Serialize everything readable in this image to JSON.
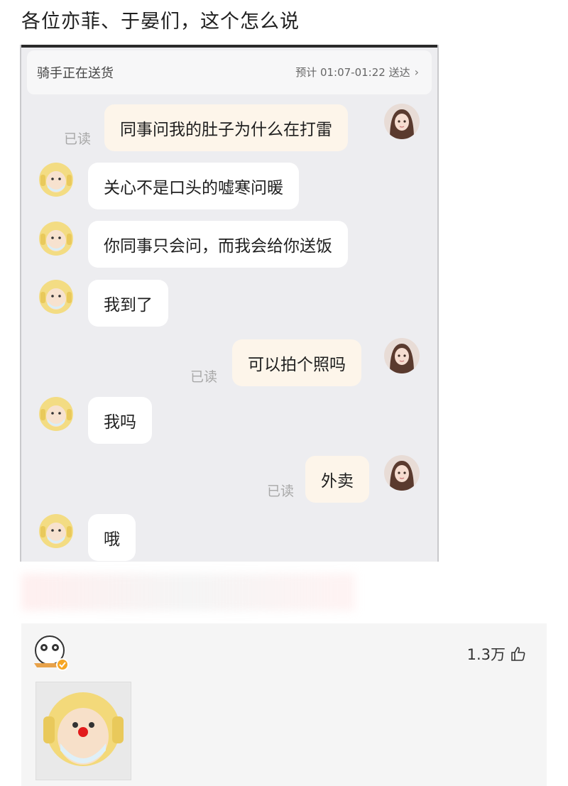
{
  "post": {
    "title": "各位亦菲、于晏们，这个怎么说"
  },
  "screenshot": {
    "status": "骑手正在送货",
    "eta": "预计 01:07-01:22 送达",
    "read_label": "已读",
    "messages": [
      {
        "from": "user",
        "text": "同事问我的肚子为什么在打雷"
      },
      {
        "from": "rider",
        "text": "关心不是口头的嘘寒问暖"
      },
      {
        "from": "rider",
        "text": "你同事只会问，而我会给你送饭"
      },
      {
        "from": "rider",
        "text": "我到了"
      },
      {
        "from": "user",
        "text": "可以拍个照吗"
      },
      {
        "from": "rider",
        "text": "我吗"
      },
      {
        "from": "user",
        "text": "外卖"
      },
      {
        "from": "rider",
        "text": "哦"
      }
    ]
  },
  "comment": {
    "likes": "1.3万",
    "like_icon": "thumbs-up-icon",
    "badge_icon": "verified-badge-icon"
  },
  "colors": {
    "user_bubble": "#fdf5ea",
    "rider_bubble": "#ffffff",
    "chat_bg": "#ededf0"
  }
}
